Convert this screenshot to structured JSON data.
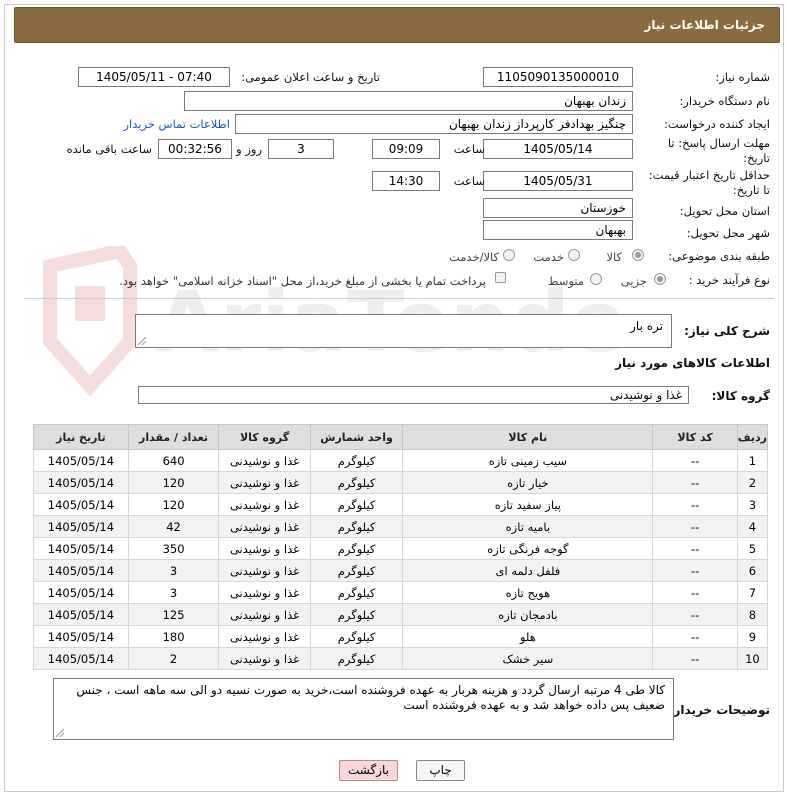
{
  "header": {
    "title": "جزئیات اطلاعات نیاز"
  },
  "fields": {
    "need_number_label": "شماره نیاز:",
    "need_number": "1105090135000010",
    "announce_label": "تاریخ و ساعت اعلان عمومی:",
    "announce_value": "1405/05/11 - 07:40",
    "buyer_org_label": "نام دستگاه خریدار:",
    "buyer_org": "زندان بهبهان",
    "creator_label": "ایجاد کننده درخواست:",
    "creator": "چنگیز بهدادفر کارپرداز زندان بهبهان",
    "contact_link": "اطلاعات تماس خریدار",
    "reply_deadline_label_1": "مهلت ارسال پاسخ: تا",
    "reply_deadline_label_2": "تاریخ:",
    "reply_date": "1405/05/14",
    "time_word": "ساعت",
    "reply_time": "09:09",
    "days_value": "3",
    "days_and": "روز و",
    "remaining_time": "00:32:56",
    "remaining_label": "ساعت باقی مانده",
    "price_deadline_label_1": "حداقل تاریخ اعتبار قیمت:",
    "price_deadline_label_2": "تا تاریخ:",
    "price_date": "1405/05/31",
    "price_time": "14:30",
    "province_label": "استان محل تحویل:",
    "province": "خوزستان",
    "city_label": "شهر محل تحویل:",
    "city": "بهبهان",
    "category_label": "طبقه بندی موضوعی:",
    "category_options": [
      "کالا",
      "خدمت",
      "کالا/خدمت"
    ],
    "category_selected": "کالا",
    "process_label": "نوع فرآیند خرید :",
    "process_options": [
      "جزیی",
      "متوسط"
    ],
    "process_selected": "جزیی",
    "payment_note": "پرداخت تمام یا بخشی از مبلغ خرید،از محل \"اسناد خزانه اسلامی\" خواهد بود."
  },
  "description": {
    "label": "شرح کلی نیاز:",
    "value": "تره بار"
  },
  "goods": {
    "section_title": "اطلاعات کالاهای مورد نیاز",
    "group_label": "گروه کالا:",
    "group_value": "غذا و نوشیدنی",
    "columns": [
      "ردیف",
      "کد کالا",
      "نام کالا",
      "واحد شمارش",
      "گروه کالا",
      "تعداد / مقدار",
      "تاریخ نیاز"
    ],
    "rows": [
      [
        "1",
        "--",
        "سیب زمینی تازه",
        "کیلوگرم",
        "غذا و نوشیدنی",
        "640",
        "1405/05/14"
      ],
      [
        "2",
        "--",
        "خیار تازه",
        "کیلوگرم",
        "غذا و نوشیدنی",
        "120",
        "1405/05/14"
      ],
      [
        "3",
        "--",
        "پیاز سفید تازه",
        "کیلوگرم",
        "غذا و نوشیدنی",
        "120",
        "1405/05/14"
      ],
      [
        "4",
        "--",
        "بامیه تازه",
        "کیلوگرم",
        "غذا و نوشیدنی",
        "42",
        "1405/05/14"
      ],
      [
        "5",
        "--",
        "گوجه فرنگی تازه",
        "کیلوگرم",
        "غذا و نوشیدنی",
        "350",
        "1405/05/14"
      ],
      [
        "6",
        "--",
        "فلفل دلمه ای",
        "کیلوگرم",
        "غذا و نوشیدنی",
        "3",
        "1405/05/14"
      ],
      [
        "7",
        "--",
        "هویج تازه",
        "کیلوگرم",
        "غذا و نوشیدنی",
        "3",
        "1405/05/14"
      ],
      [
        "8",
        "--",
        "بادمجان تازه",
        "کیلوگرم",
        "غذا و نوشیدنی",
        "125",
        "1405/05/14"
      ],
      [
        "9",
        "--",
        "هلو",
        "کیلوگرم",
        "غذا و نوشیدنی",
        "180",
        "1405/05/14"
      ],
      [
        "10",
        "--",
        "سیر خشک",
        "کیلوگرم",
        "غذا و نوشیدنی",
        "2",
        "1405/05/14"
      ]
    ]
  },
  "buyer_notes": {
    "label": "توضیحات خریدار:",
    "value": "کالا طی 4 مرتبه ارسال گردد و هزینه هربار به عهده فروشنده است،خرید به صورت نسیه دو الی سه ماهه است ، جنس ضعیف پس داده خواهد شد و به عهده فروشنده است"
  },
  "buttons": {
    "print": "چاپ",
    "back": "بازگشت"
  },
  "watermark": {
    "text": "AriaTender.neT"
  },
  "colors": {
    "title_bg": "#8a6b40",
    "link": "#1d57c4",
    "back_button": "#f7d7d7"
  }
}
